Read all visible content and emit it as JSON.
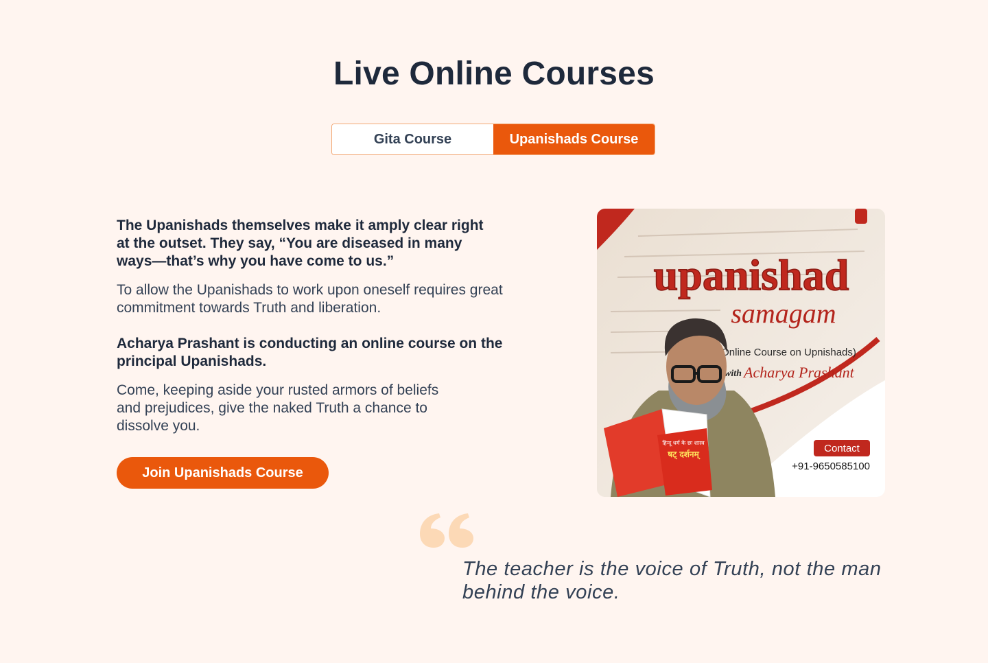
{
  "page": {
    "title": "Live Online Courses"
  },
  "tabs": [
    {
      "label": "Gita Course",
      "active": false
    },
    {
      "label": "Upanishads Course",
      "active": true
    }
  ],
  "content": {
    "lead1": "The Upanishads themselves make it amply clear right at the outset. They say, “You are diseased in many ways—that’s why you have come to us.”",
    "para1": "To allow the Upanishads to work upon oneself requires great commitment towards Truth and liberation.",
    "lead2": "Acharya Prashant is conducting an online course on the principal Upanishads.",
    "para2": "Come, keeping aside your rusted armors of beliefs and prejudices, give the naked Truth a chance to dissolve you.",
    "cta_label": "Join Upanishads Course"
  },
  "poster": {
    "title": "upanishad",
    "subtitle": "samagam",
    "description": "(Online Course on Upnishads)",
    "with_label": "with",
    "teacher": "Acharya Prashant",
    "contact_label": "Contact",
    "phone": "+91-9650585100",
    "book_title": "षट् दर्शनम्",
    "book_cover_text": "हिन्दू धर्म के छः शास्त्र"
  },
  "quote": {
    "text": "The teacher is the voice of Truth, not the man behind the voice."
  },
  "colors": {
    "accent": "#ea580c",
    "background": "#fff5f0",
    "heading": "#1e293b",
    "quote_mark": "#fcd9b6"
  }
}
